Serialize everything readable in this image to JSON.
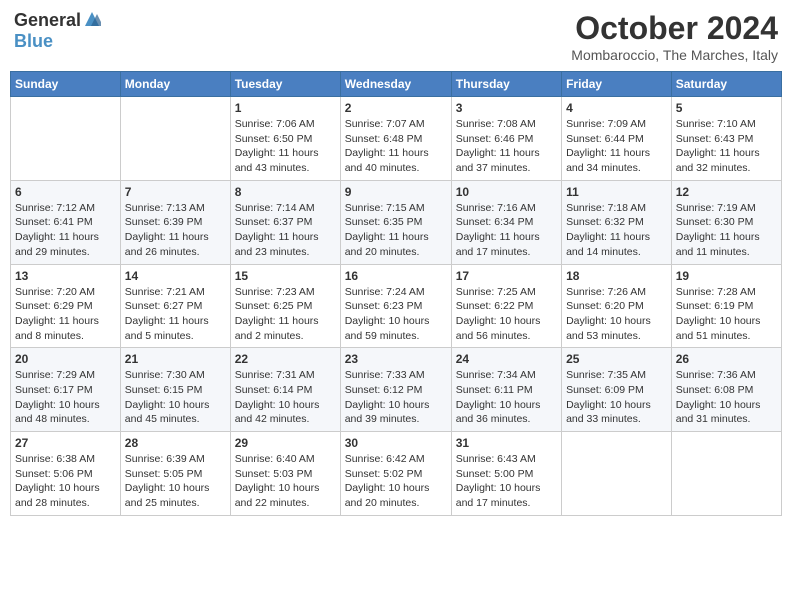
{
  "header": {
    "logo_general": "General",
    "logo_blue": "Blue",
    "month": "October 2024",
    "location": "Mombaroccio, The Marches, Italy"
  },
  "days_of_week": [
    "Sunday",
    "Monday",
    "Tuesday",
    "Wednesday",
    "Thursday",
    "Friday",
    "Saturday"
  ],
  "weeks": [
    [
      {
        "day": "",
        "info": ""
      },
      {
        "day": "",
        "info": ""
      },
      {
        "day": "1",
        "info": "Sunrise: 7:06 AM\nSunset: 6:50 PM\nDaylight: 11 hours and 43 minutes."
      },
      {
        "day": "2",
        "info": "Sunrise: 7:07 AM\nSunset: 6:48 PM\nDaylight: 11 hours and 40 minutes."
      },
      {
        "day": "3",
        "info": "Sunrise: 7:08 AM\nSunset: 6:46 PM\nDaylight: 11 hours and 37 minutes."
      },
      {
        "day": "4",
        "info": "Sunrise: 7:09 AM\nSunset: 6:44 PM\nDaylight: 11 hours and 34 minutes."
      },
      {
        "day": "5",
        "info": "Sunrise: 7:10 AM\nSunset: 6:43 PM\nDaylight: 11 hours and 32 minutes."
      }
    ],
    [
      {
        "day": "6",
        "info": "Sunrise: 7:12 AM\nSunset: 6:41 PM\nDaylight: 11 hours and 29 minutes."
      },
      {
        "day": "7",
        "info": "Sunrise: 7:13 AM\nSunset: 6:39 PM\nDaylight: 11 hours and 26 minutes."
      },
      {
        "day": "8",
        "info": "Sunrise: 7:14 AM\nSunset: 6:37 PM\nDaylight: 11 hours and 23 minutes."
      },
      {
        "day": "9",
        "info": "Sunrise: 7:15 AM\nSunset: 6:35 PM\nDaylight: 11 hours and 20 minutes."
      },
      {
        "day": "10",
        "info": "Sunrise: 7:16 AM\nSunset: 6:34 PM\nDaylight: 11 hours and 17 minutes."
      },
      {
        "day": "11",
        "info": "Sunrise: 7:18 AM\nSunset: 6:32 PM\nDaylight: 11 hours and 14 minutes."
      },
      {
        "day": "12",
        "info": "Sunrise: 7:19 AM\nSunset: 6:30 PM\nDaylight: 11 hours and 11 minutes."
      }
    ],
    [
      {
        "day": "13",
        "info": "Sunrise: 7:20 AM\nSunset: 6:29 PM\nDaylight: 11 hours and 8 minutes."
      },
      {
        "day": "14",
        "info": "Sunrise: 7:21 AM\nSunset: 6:27 PM\nDaylight: 11 hours and 5 minutes."
      },
      {
        "day": "15",
        "info": "Sunrise: 7:23 AM\nSunset: 6:25 PM\nDaylight: 11 hours and 2 minutes."
      },
      {
        "day": "16",
        "info": "Sunrise: 7:24 AM\nSunset: 6:23 PM\nDaylight: 10 hours and 59 minutes."
      },
      {
        "day": "17",
        "info": "Sunrise: 7:25 AM\nSunset: 6:22 PM\nDaylight: 10 hours and 56 minutes."
      },
      {
        "day": "18",
        "info": "Sunrise: 7:26 AM\nSunset: 6:20 PM\nDaylight: 10 hours and 53 minutes."
      },
      {
        "day": "19",
        "info": "Sunrise: 7:28 AM\nSunset: 6:19 PM\nDaylight: 10 hours and 51 minutes."
      }
    ],
    [
      {
        "day": "20",
        "info": "Sunrise: 7:29 AM\nSunset: 6:17 PM\nDaylight: 10 hours and 48 minutes."
      },
      {
        "day": "21",
        "info": "Sunrise: 7:30 AM\nSunset: 6:15 PM\nDaylight: 10 hours and 45 minutes."
      },
      {
        "day": "22",
        "info": "Sunrise: 7:31 AM\nSunset: 6:14 PM\nDaylight: 10 hours and 42 minutes."
      },
      {
        "day": "23",
        "info": "Sunrise: 7:33 AM\nSunset: 6:12 PM\nDaylight: 10 hours and 39 minutes."
      },
      {
        "day": "24",
        "info": "Sunrise: 7:34 AM\nSunset: 6:11 PM\nDaylight: 10 hours and 36 minutes."
      },
      {
        "day": "25",
        "info": "Sunrise: 7:35 AM\nSunset: 6:09 PM\nDaylight: 10 hours and 33 minutes."
      },
      {
        "day": "26",
        "info": "Sunrise: 7:36 AM\nSunset: 6:08 PM\nDaylight: 10 hours and 31 minutes."
      }
    ],
    [
      {
        "day": "27",
        "info": "Sunrise: 6:38 AM\nSunset: 5:06 PM\nDaylight: 10 hours and 28 minutes."
      },
      {
        "day": "28",
        "info": "Sunrise: 6:39 AM\nSunset: 5:05 PM\nDaylight: 10 hours and 25 minutes."
      },
      {
        "day": "29",
        "info": "Sunrise: 6:40 AM\nSunset: 5:03 PM\nDaylight: 10 hours and 22 minutes."
      },
      {
        "day": "30",
        "info": "Sunrise: 6:42 AM\nSunset: 5:02 PM\nDaylight: 10 hours and 20 minutes."
      },
      {
        "day": "31",
        "info": "Sunrise: 6:43 AM\nSunset: 5:00 PM\nDaylight: 10 hours and 17 minutes."
      },
      {
        "day": "",
        "info": ""
      },
      {
        "day": "",
        "info": ""
      }
    ]
  ]
}
